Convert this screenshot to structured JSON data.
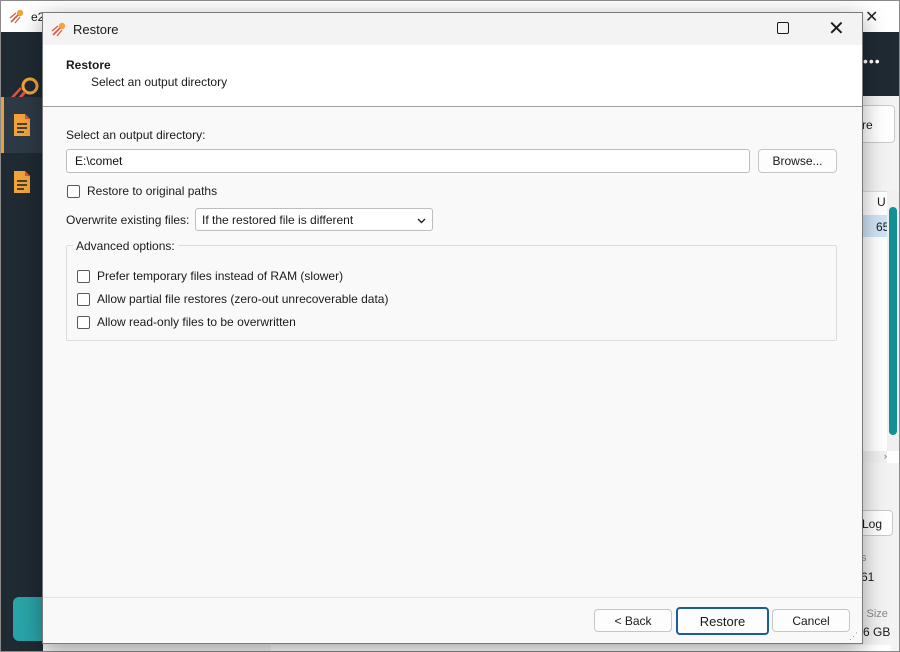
{
  "background_app": {
    "title": "e2",
    "topbar_more": "•••",
    "button_partial_label": "re",
    "table_header_partial": "U",
    "table_cell_partial": "65",
    "log_button_partial": "Log",
    "stat_label_1": "s",
    "stat_value_1": "61",
    "stat_label_2": "l Size",
    "stat_value_2": "6 GB",
    "hscroll_arrow": "›",
    "accent_color": "#138f96",
    "sidebar_color": "#1f2a33"
  },
  "dialog": {
    "title": "Restore",
    "close_glyph": "✕",
    "header": {
      "title": "Restore",
      "subtitle": "Select an output directory"
    },
    "output_directory": {
      "label": "Select an output directory:",
      "value": "E:\\comet",
      "browse_label": "Browse..."
    },
    "restore_original_paths": {
      "label": "Restore to original paths",
      "checked": false
    },
    "overwrite": {
      "label": "Overwrite existing files:",
      "selected": "If the restored file is different"
    },
    "advanced": {
      "legend": "Advanced options:",
      "options": [
        {
          "label": "Prefer temporary files instead of RAM (slower)",
          "checked": false
        },
        {
          "label": "Allow partial file restores (zero-out unrecoverable data)",
          "checked": false
        },
        {
          "label": "Allow read-only files to be overwritten",
          "checked": false
        }
      ]
    },
    "footer": {
      "back_label": "< Back",
      "restore_label": "Restore",
      "cancel_label": "Cancel"
    }
  }
}
